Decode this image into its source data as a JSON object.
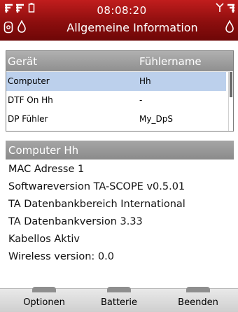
{
  "statusbar": {
    "time": "08:08:20",
    "title": "Allgemeine Information",
    "icons": [
      "signal-icon",
      "signal-secondary-icon",
      "battery-icon",
      "antenna-icon",
      "device-icon",
      "drop-icon",
      "drop-right-icon"
    ],
    "accent_color": "#a01414"
  },
  "table": {
    "headers": {
      "device": "Gerät",
      "sensor": "Fühlername"
    },
    "rows": [
      {
        "device": "Computer",
        "sensor": "Hh",
        "selected": true
      },
      {
        "device": "DTF On Hh",
        "sensor": "-",
        "selected": false
      },
      {
        "device": "DP Fühler",
        "sensor": "My_DpS",
        "selected": false
      }
    ],
    "selection_color": "#bcd0ec"
  },
  "details": {
    "header": "Computer Hh",
    "lines": [
      "MAC Adresse 1",
      "Softwareversion TA-SCOPE v0.5.01",
      "TA Datenbankbereich International",
      "TA Datenbankversion 3.33",
      "Kabellos Aktiv",
      "Wireless version: 0.0"
    ]
  },
  "softkeys": {
    "options": "Optionen",
    "battery": "Batterie",
    "exit": "Beenden"
  }
}
